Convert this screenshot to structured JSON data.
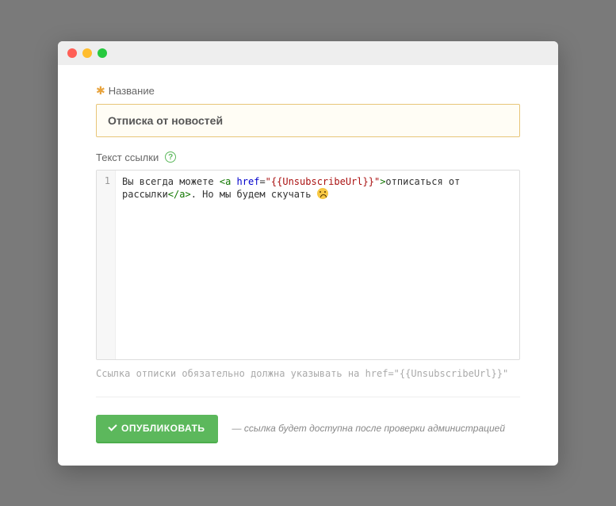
{
  "labels": {
    "title": "Название",
    "link_text": "Текст ссылки"
  },
  "form": {
    "title_value": "Отписка от новостей"
  },
  "code": {
    "line_no": "1",
    "parts": {
      "pre": "Вы всегда можете ",
      "open_bracket": "<",
      "tag_a_open": "a",
      "space": " ",
      "attr_href": "href",
      "eq": "=",
      "q1": "\"",
      "url": "{{UnsubscribeUrl}}",
      "q2": "\"",
      "close_bracket": ">",
      "link_text": "отписаться от рассылки",
      "close_tag_open": "</",
      "tag_a_close": "a",
      "close_tag_close": ">",
      "tail": ". Но мы будем скучать "
    }
  },
  "hint": {
    "prefix": "Ссылка отписки обязательно должна указывать на ",
    "snippet": "href=\"{{UnsubscribeUrl}}\""
  },
  "footer": {
    "publish": "ОПУБЛИКОВАТЬ",
    "note": "— ссылка будет доступна после проверки администрацией"
  }
}
